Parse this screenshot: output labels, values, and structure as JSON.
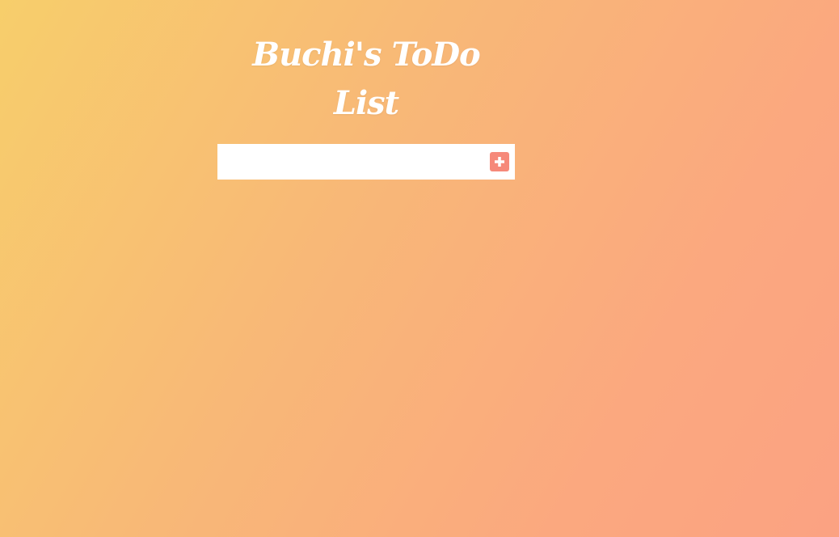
{
  "header": {
    "title": "Buchi's ToDo List"
  },
  "form": {
    "input_value": "",
    "input_placeholder": "",
    "add_button_icon": "plus-square-icon"
  },
  "colors": {
    "gradient_start": "#f7ce6b",
    "gradient_end": "#fba282",
    "add_button": "#f6897a",
    "input_background": "#ffffff",
    "title": "#ffffff"
  },
  "todos": []
}
